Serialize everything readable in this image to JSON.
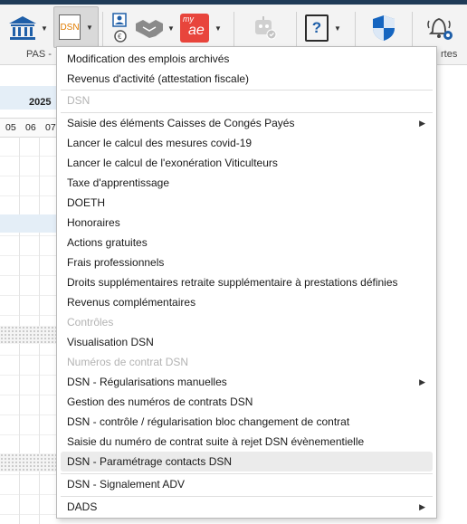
{
  "ribbon": {
    "group_label_left": "PAS -",
    "group_label_right": "rtes",
    "buttons": {
      "bank": "bank-icon",
      "dsn": "DSN",
      "contacts": "contact-card-icon",
      "handshake": "handshake-icon",
      "myae": "my",
      "myae_sub": "ae",
      "robot": "robot-icon",
      "help": "?",
      "shield": "shield-icon",
      "alerts": "bell-gear-icon"
    }
  },
  "calendar": {
    "year": "2025",
    "days": [
      "05",
      "06",
      "07"
    ]
  },
  "menu": {
    "items": [
      {
        "label": "Modification des emplois archivés",
        "enabled": true
      },
      {
        "label": "Revenus d'activité (attestation fiscale)",
        "enabled": true
      },
      {
        "label": "DSN",
        "enabled": false
      },
      {
        "label": "Saisie des éléments Caisses de Congés Payés",
        "enabled": true,
        "submenu": true
      },
      {
        "label": "Lancer le calcul des mesures covid-19",
        "enabled": true
      },
      {
        "label": "Lancer le calcul de l'exonération Viticulteurs",
        "enabled": true
      },
      {
        "label": "Taxe d'apprentissage",
        "enabled": true
      },
      {
        "label": "DOETH",
        "enabled": true
      },
      {
        "label": "Honoraires",
        "enabled": true
      },
      {
        "label": "Actions gratuites",
        "enabled": true
      },
      {
        "label": "Frais professionnels",
        "enabled": true
      },
      {
        "label": "Droits supplémentaires retraite supplémentaire à prestations définies",
        "enabled": true
      },
      {
        "label": "Revenus complémentaires",
        "enabled": true
      },
      {
        "label": "Contrôles",
        "enabled": false
      },
      {
        "label": "Visualisation DSN",
        "enabled": true
      },
      {
        "label": "Numéros de contrat DSN",
        "enabled": false
      },
      {
        "label": "DSN - Régularisations manuelles",
        "enabled": true,
        "submenu": true
      },
      {
        "label": "Gestion des numéros de contrats DSN",
        "enabled": true
      },
      {
        "label": "DSN - contrôle / régularisation bloc changement de contrat",
        "enabled": true
      },
      {
        "label": "Saisie du numéro de contrat suite à rejet DSN évènementielle",
        "enabled": true
      },
      {
        "label": "DSN - Paramétrage contacts DSN",
        "enabled": true,
        "highlighted": true
      },
      {
        "label": "DSN - Signalement ADV",
        "enabled": true
      },
      {
        "label": "DADS",
        "enabled": true,
        "submenu": true
      }
    ],
    "submenu_arrow": "▶"
  },
  "colors": {
    "accent_red": "#e8453c",
    "shield_blue": "#1565c0",
    "bank_blue": "#1f5fa8"
  }
}
